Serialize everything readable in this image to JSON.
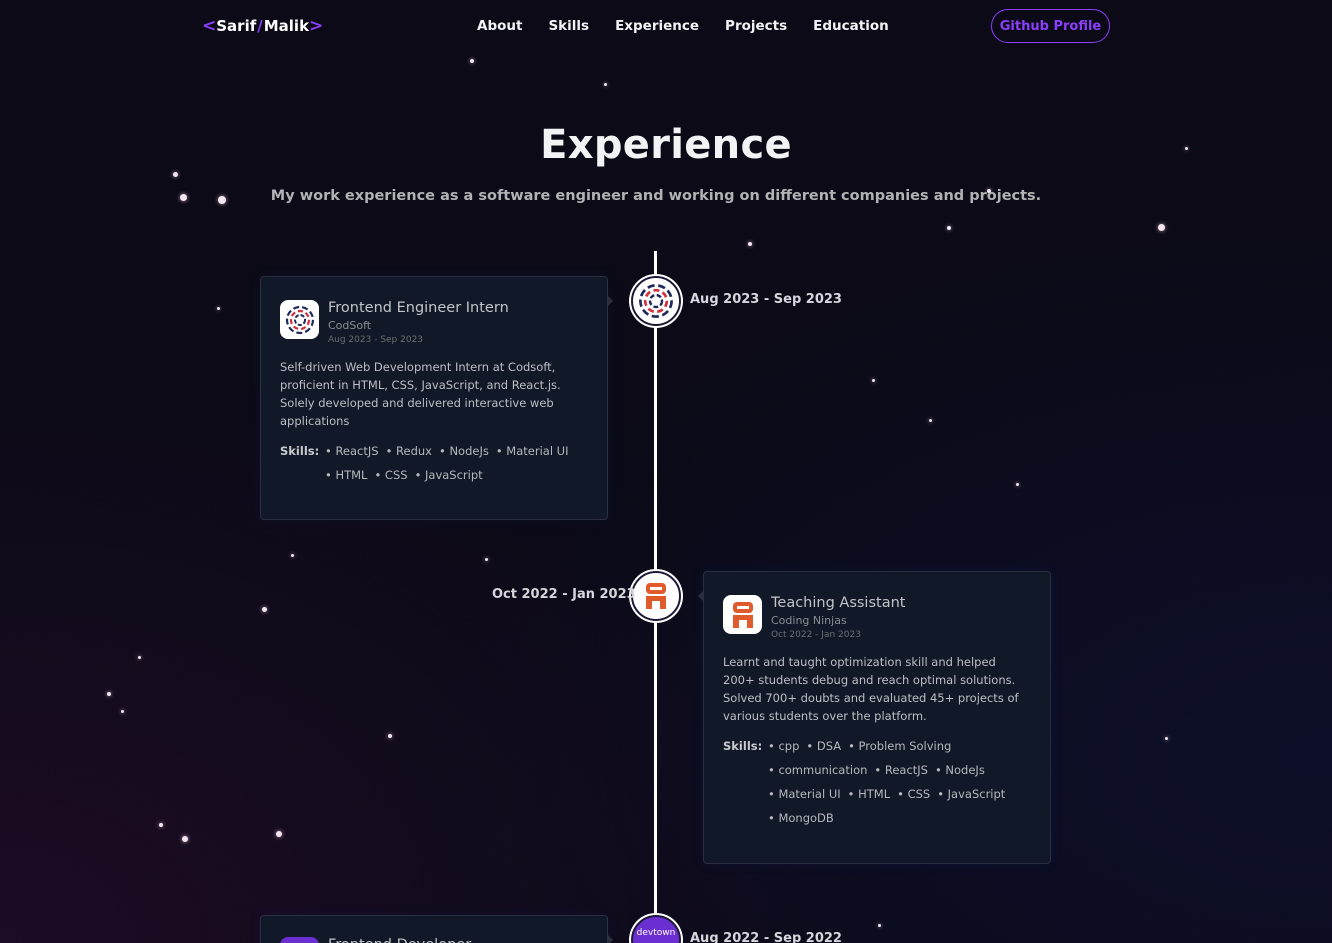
{
  "nav": {
    "logo_first": "Sarif",
    "logo_slash": "/",
    "logo_second": "Malik",
    "logo_lt": "<",
    "logo_gt": ">",
    "links": [
      "About",
      "Skills",
      "Experience",
      "Projects",
      "Education"
    ],
    "github_label": "Github Profile"
  },
  "section": {
    "title": "Experience",
    "subtitle": "My work experience as a software engineer and working on different companies and projects."
  },
  "experiences": [
    {
      "role": "Frontend Engineer Intern",
      "company": "CodSoft",
      "dates": "Aug 2023 - Sep 2023",
      "timeline_date": "Aug 2023 - Sep 2023",
      "description": "Self-driven Web Development Intern at Codsoft, proficient in HTML, CSS, JavaScript, and React.js. Solely developed and delivered interactive web applications",
      "skills_label": "Skills:",
      "skills": [
        "ReactJS",
        "Redux",
        "NodeJs",
        "Material UI",
        "HTML",
        "CSS",
        "JavaScript"
      ],
      "logo_icon": "codsoft-logo-icon"
    },
    {
      "role": "Teaching Assistant",
      "company": "Coding Ninjas",
      "dates": "Oct 2022 - Jan 2023",
      "timeline_date": "Oct 2022 - Jan 2023",
      "description": "Learnt and taught optimization skill and helped 200+ students debug and reach optimal solutions. Solved 700+ doubts and evaluated 45+ projects of various students over the platform.",
      "skills_label": "Skills:",
      "skills": [
        "cpp",
        "DSA",
        "Problem Solving",
        "communication",
        "ReactJS",
        "NodeJs",
        "Material UI",
        "HTML",
        "CSS",
        "JavaScript",
        "MongoDB"
      ],
      "logo_icon": "coding-ninjas-logo-icon"
    },
    {
      "role": "Frontend Developer",
      "timeline_date": "Aug 2022 - Sep 2022",
      "logo_text": "devtown",
      "logo_icon": "devtown-logo-icon"
    }
  ],
  "colors": {
    "accent": "#8a3ffc",
    "background": "#0b0a16",
    "card": "#111827"
  }
}
